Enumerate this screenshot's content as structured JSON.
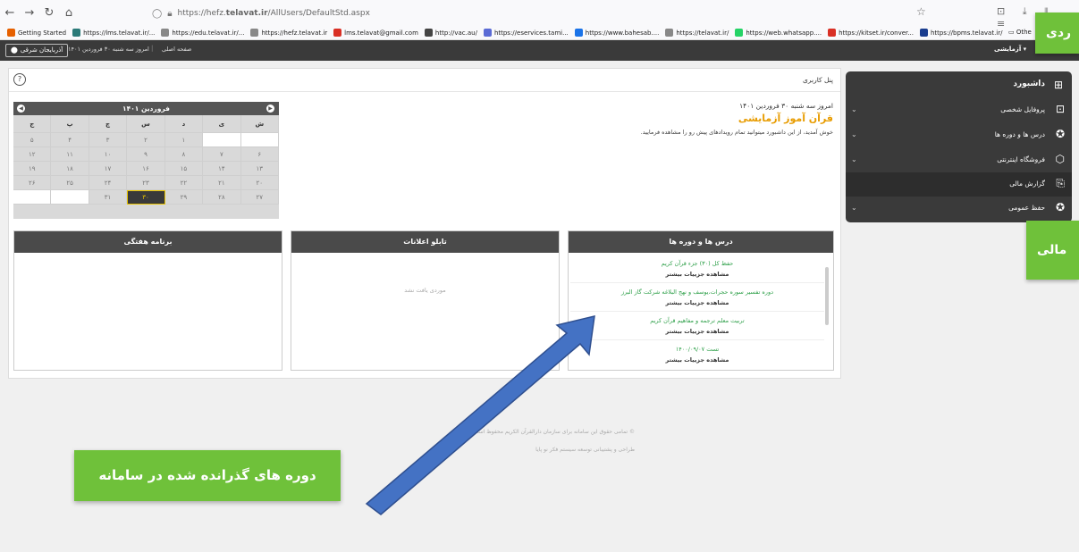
{
  "browser": {
    "url_prefix": "https://hefz.",
    "url_host": "telavat.ir",
    "url_path": "/AllUsers/DefaultStd.aspx",
    "bookmarks": [
      {
        "label": "Getting Started",
        "color": "#e66000"
      },
      {
        "label": "https://lms.telavat.ir/...",
        "color": "#2b7a78"
      },
      {
        "label": "https://edu.telavat.ir/...",
        "color": "#888888"
      },
      {
        "label": "https://hefz.telavat.ir",
        "color": "#888888"
      },
      {
        "label": "lms.telavat@gmail.com",
        "color": "#d93025"
      },
      {
        "label": "http://vac.au/",
        "color": "#444444"
      },
      {
        "label": "https://eservices.tami...",
        "color": "#5b6bd5"
      },
      {
        "label": "https://www.bahesab....",
        "color": "#1a73e8"
      },
      {
        "label": "https://telavat.ir/",
        "color": "#888888"
      },
      {
        "label": "https://web.whatsapp....",
        "color": "#25d366"
      },
      {
        "label": "https://kitset.ir/conver...",
        "color": "#d93025"
      },
      {
        "label": "https://bpms.telavat.ir/",
        "color": "#1a3d8f"
      }
    ],
    "other_bookmarks": "Othe"
  },
  "header": {
    "province": "آذربایجان شرقی",
    "date": "امروز سه شنبه ۳۰ فروردین ۱۴۰۱",
    "separator": "|",
    "home": "صفحه اصلی",
    "user": "آزمایشی"
  },
  "panel": {
    "title": "پنل کاربری",
    "help": "?"
  },
  "calendar": {
    "month": "فروردین ۱۴۰۱",
    "weekdays": [
      "ج",
      "پ",
      "چ",
      "س",
      "د",
      "ی",
      "ش"
    ],
    "rows": [
      [
        "۵",
        "۴",
        "۳",
        "۲",
        "۱",
        "",
        ""
      ],
      [
        "۱۲",
        "۱۱",
        "۱۰",
        "۹",
        "۸",
        "۷",
        "۶"
      ],
      [
        "۱۹",
        "۱۸",
        "۱۷",
        "۱۶",
        "۱۵",
        "۱۴",
        "۱۳"
      ],
      [
        "۲۶",
        "۲۵",
        "۲۴",
        "۲۳",
        "۲۲",
        "۲۱",
        "۲۰"
      ],
      [
        "",
        "",
        "۳۱",
        "۳۰",
        "۲۹",
        "۲۸",
        "۲۷"
      ]
    ],
    "today": "۳۰"
  },
  "welcome": {
    "date": "امروز سه شنبه ۳۰ فروردین ۱۴۰۱",
    "name": "قرآن آموز آزمایشی",
    "message": "خوش آمدید، از این داشبورد میتوانید تمام رویدادهای پیش رو را مشاهده فرمایید."
  },
  "boxes": {
    "weekly": "برنامه هفتگی",
    "notices": "تابلو اعلانات",
    "notices_empty": "موردی یافت نشد",
    "courses": "درس ها و دوره ها"
  },
  "courses": [
    {
      "name": "حفظ کل (۳۰) جزء قرآن کریم",
      "link": "مشاهده جزییات بیشتر"
    },
    {
      "name": "دوره تفسیر سوره حجرات،یوسف و نهج البلاغه شرکت گاز البرز",
      "link": "مشاهده جزییات بیشتر"
    },
    {
      "name": "تربیت معلم ترجمه و مفاهیم قرآن کریم",
      "link": "مشاهده جزییات بیشتر"
    },
    {
      "name": "تست ۱۴۰۰/۰۹/۰۷",
      "link": "مشاهده جزییات بیشتر"
    }
  ],
  "footer": {
    "line1": "© تمامی حقوق این سامانه برای سازمان دارالقرآن الکریم محفوظ است.",
    "line2": "طراحی و پشتیبانی توسعه سیستم فکر نو پایا"
  },
  "sidebar": {
    "dashboard": "داشبورد",
    "items": [
      {
        "label": "پروفایل شخصی",
        "icon": "profile-icon"
      },
      {
        "label": "درس ها و دوره ها",
        "icon": "reader-icon"
      },
      {
        "label": "فروشگاه اینترنتی",
        "icon": "box-icon"
      },
      {
        "label": "گزارش مالی",
        "icon": "report-icon"
      },
      {
        "label": "حفظ عمومی",
        "icon": "reader-icon"
      }
    ]
  },
  "annotations": {
    "tab_top": "ردی",
    "tab_mid": "مالی",
    "callout": "دوره های گذرانده شده در سامانه"
  },
  "colors": {
    "accent_green": "#6fc13a",
    "arrow_blue": "#4472c4",
    "brand_orange": "#e89c00",
    "course_green": "#2fa04a"
  }
}
